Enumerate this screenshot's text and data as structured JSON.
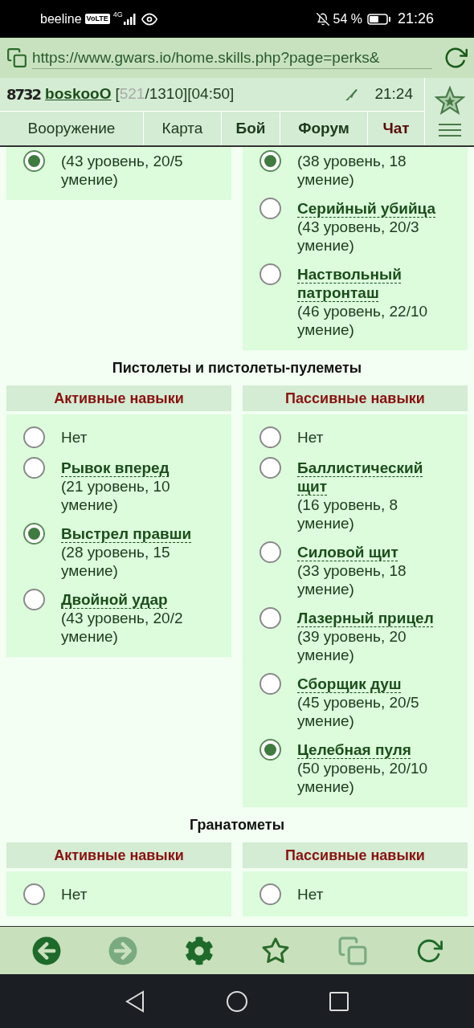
{
  "status_bar": {
    "carrier": "beeline",
    "volte": "VoLTE",
    "network": "4G",
    "battery": "54 %",
    "time": "21:26"
  },
  "address_bar": {
    "url": "https://www.gwars.io/home.skills.php?page=perks&"
  },
  "game_header": {
    "code": "8732",
    "player": "boskooO",
    "prefix": "[",
    "hp": "521",
    "suffix": "/1310][04:50]",
    "server_time": "21:24",
    "nav": [
      {
        "label": "Вооружение",
        "bold": false,
        "highlight": false
      },
      {
        "label": "Карта",
        "bold": false,
        "highlight": false
      },
      {
        "label": "Бой",
        "bold": true,
        "highlight": false
      },
      {
        "label": "Форум",
        "bold": true,
        "highlight": false
      },
      {
        "label": "Чат",
        "bold": true,
        "highlight": true
      }
    ]
  },
  "sections": [
    {
      "columns": [
        {
          "items": [
            {
              "detail": "(43 уровень, 20/5 умение)",
              "selected": true
            }
          ]
        },
        {
          "items": [
            {
              "detail": "(38 уровень, 18 умение)",
              "selected": true
            },
            {
              "name": "Серийный убийца",
              "detail": "(43 уровень, 20/3 умение)",
              "selected": false
            },
            {
              "name": "Наствольный патронташ",
              "detail": "(46 уровень, 22/10 умение)",
              "selected": false
            }
          ]
        }
      ]
    },
    {
      "title": "Пистолеты и пистолеты-пулеметы",
      "columns": [
        {
          "header": "Активные навыки",
          "items": [
            {
              "name": "Нет",
              "kind": "none",
              "selected": false
            },
            {
              "name": "Рывок вперед",
              "detail": "(21 уровень, 10 умение)",
              "selected": false
            },
            {
              "name": "Выстрел правши",
              "detail": "(28 уровень, 15 умение)",
              "selected": true
            },
            {
              "name": "Двойной удар",
              "detail": "(43 уровень, 20/2 умение)",
              "selected": false
            }
          ]
        },
        {
          "header": "Пассивные навыки",
          "items": [
            {
              "name": "Нет",
              "kind": "none",
              "selected": false
            },
            {
              "name": "Баллистический щит",
              "detail": "(16 уровень, 8 умение)",
              "selected": false
            },
            {
              "name": "Силовой щит",
              "detail": "(33 уровень, 18 умение)",
              "selected": false
            },
            {
              "name": "Лазерный прицел",
              "detail": "(39 уровень, 20 умение)",
              "selected": false
            },
            {
              "name": "Сборщик душ",
              "detail": "(45 уровень, 20/5 умение)",
              "selected": false
            },
            {
              "name": "Целебная пуля",
              "detail": "(50 уровень, 20/10 умение)",
              "selected": true
            }
          ]
        }
      ]
    },
    {
      "title": "Гранатометы",
      "columns": [
        {
          "header": "Активные навыки",
          "items": [
            {
              "name": "Нет",
              "kind": "none",
              "selected": false
            }
          ]
        },
        {
          "header": "Пассивные навыки",
          "items": [
            {
              "name": "Нет",
              "kind": "none",
              "selected": false
            }
          ]
        }
      ]
    }
  ]
}
